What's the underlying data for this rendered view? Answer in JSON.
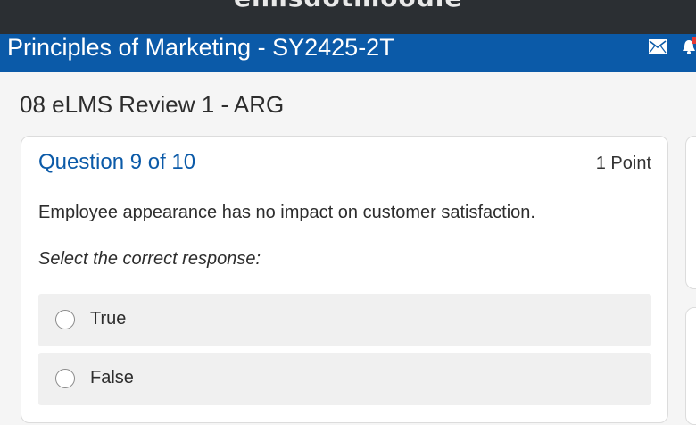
{
  "topbar": {
    "brand": "elmsdotmoodle"
  },
  "course": {
    "title": "Principles of Marketing - SY2425-2T",
    "icons": [
      "mail-icon",
      "bell-icon"
    ]
  },
  "page": {
    "heading": "08 eLMS Review 1 - ARG"
  },
  "question": {
    "number_label": "Question 9 of 10",
    "points": "1 Point",
    "text": "Employee appearance has no impact on customer satisfaction.",
    "instruction": "Select the correct response:",
    "options": [
      {
        "label": "True",
        "selected": false
      },
      {
        "label": "False",
        "selected": false
      }
    ]
  },
  "colors": {
    "topbar": "#2b2f33",
    "course_bar": "#0b5aa8",
    "accent": "#0b5aa8",
    "notification": "#e53935"
  }
}
